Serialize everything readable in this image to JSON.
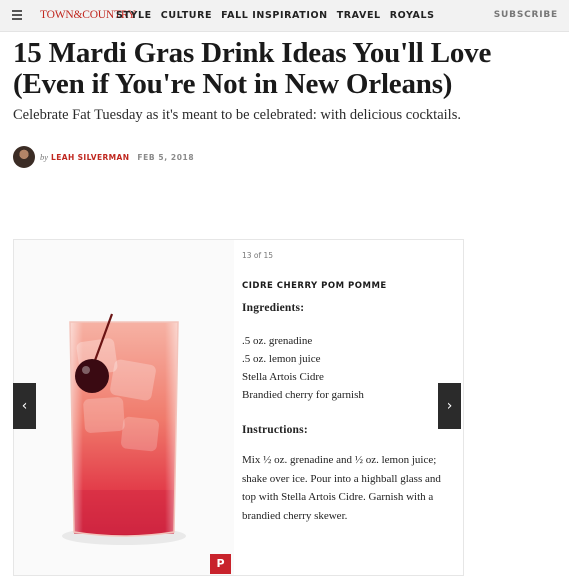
{
  "nav": {
    "logo": "TOWN&COUNTRY",
    "links": [
      "STYLE",
      "CULTURE",
      "FALL INSPIRATION",
      "TRAVEL",
      "ROYALS"
    ],
    "subscribe": "SUBSCRIBE"
  },
  "article": {
    "headline": "15 Mardi Gras Drink Ideas You'll Love (Even if You're Not in New Orleans)",
    "dek": "Celebrate Fat Tuesday as it's meant to be celebrated: with delicious cocktails.",
    "byline_prefix": "by",
    "author": "LEAH SILVERMAN",
    "date": "FEB 5, 2018"
  },
  "slide": {
    "counter": "13 of 15",
    "title": "CIDRE CHERRY POM POMME",
    "ingredients_heading": "Ingredients:",
    "ingredients": [
      ".5 oz. grenadine",
      ".5 oz. lemon juice",
      "Stella Artois Cidre",
      "Brandied cherry for garnish"
    ],
    "instructions_heading": "Instructions:",
    "instructions": "Mix ½ oz. grenadine and ½ oz. lemon juice; shake over ice. Pour into a highball glass and top with Stella Artois Cidre. Garnish with a brandied cherry skewer.",
    "pin_label": "P",
    "prev_label": "‹",
    "next_label": "›"
  },
  "icons": {
    "menu": "hamburger-icon",
    "pinterest": "pinterest-icon",
    "prev": "chevron-left-icon",
    "next": "chevron-right-icon"
  },
  "colors": {
    "brand_red": "#c0271f",
    "pinterest_red": "#c8232c",
    "arrow_bg": "#2b2b2b",
    "nav_bg": "#f2f2f2"
  }
}
